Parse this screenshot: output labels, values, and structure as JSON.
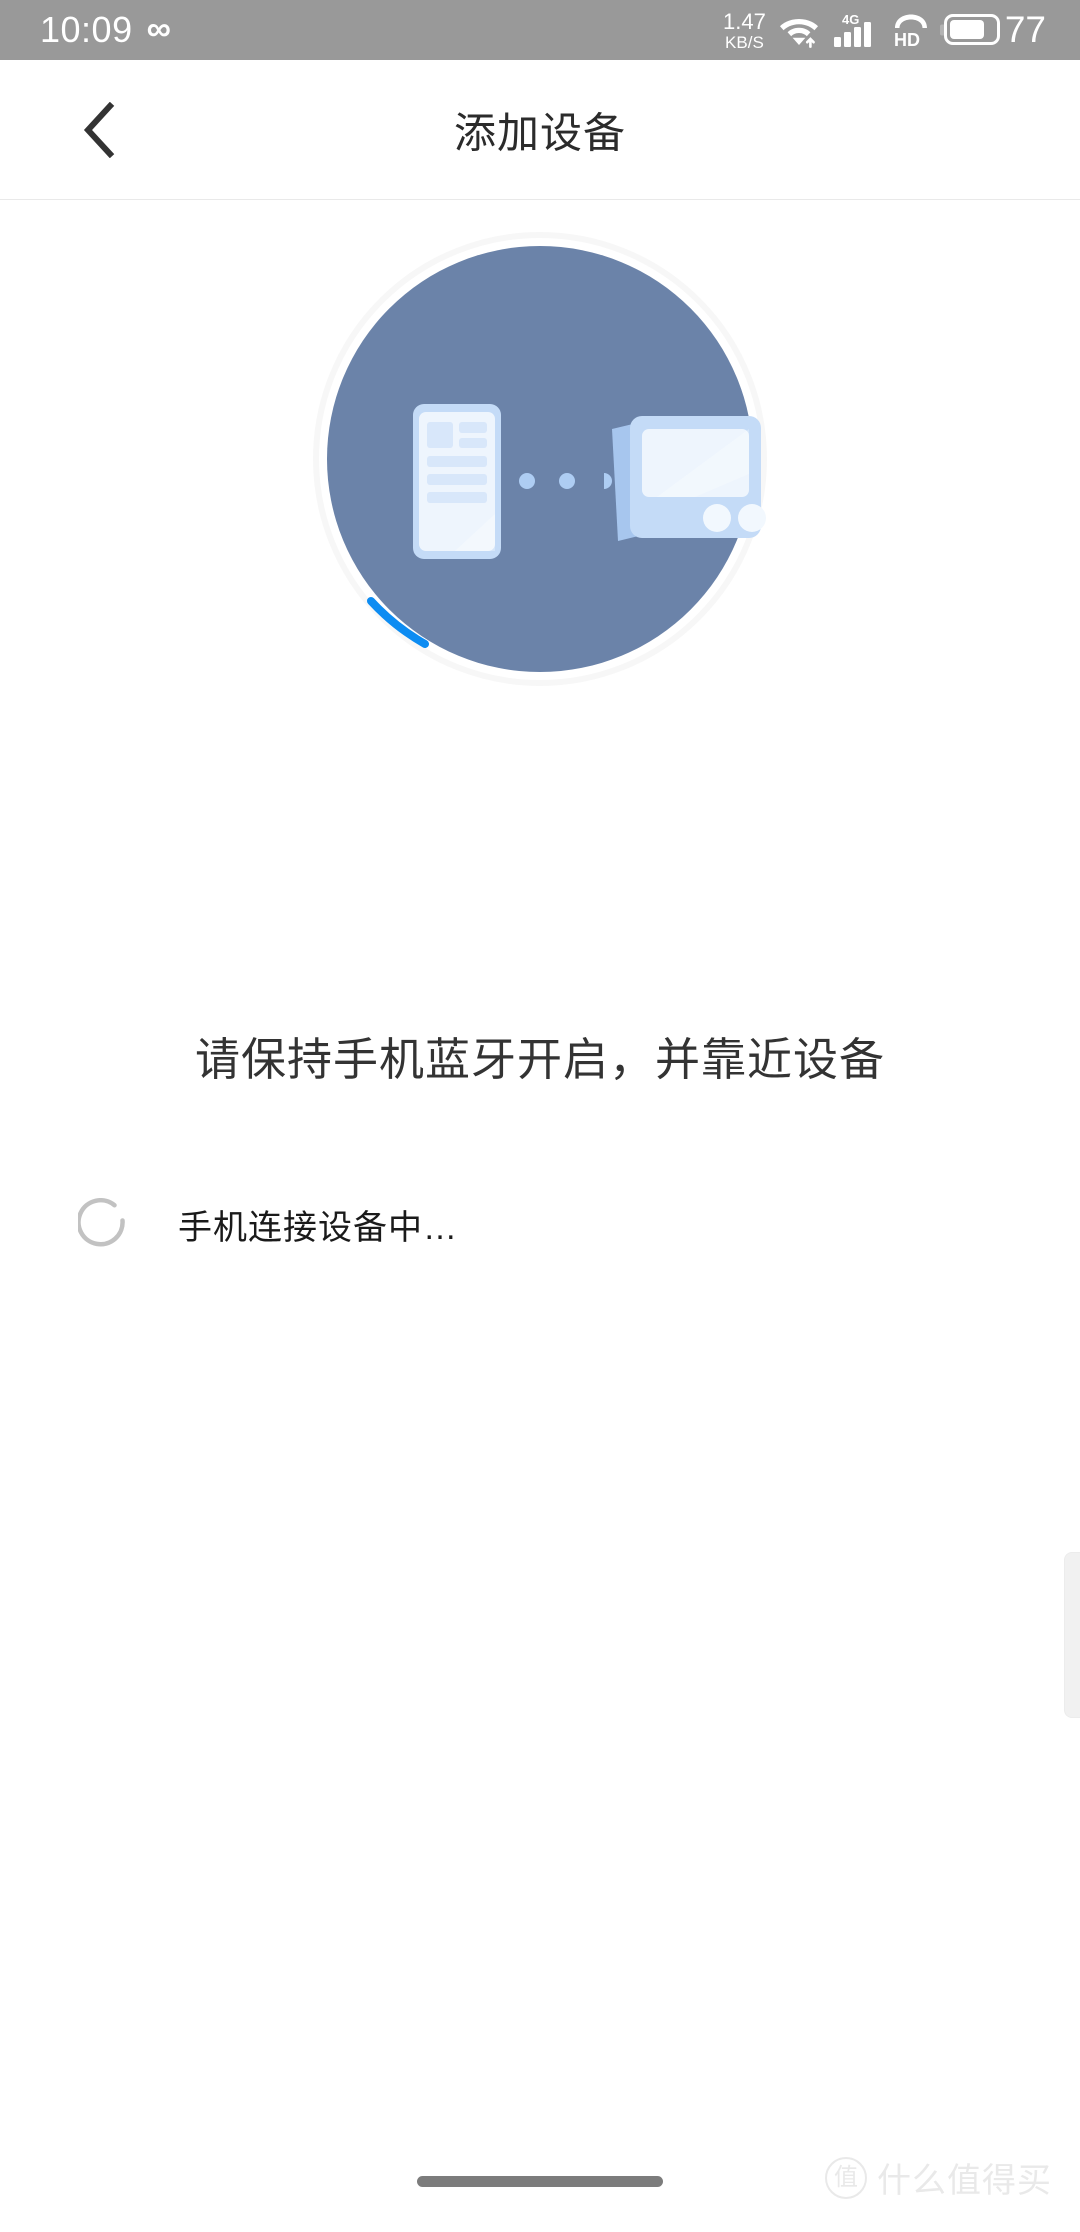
{
  "status_bar": {
    "time": "10:09",
    "infinity_icon": "infinity-icon",
    "network_speed_value": "1.47",
    "network_speed_unit": "KB/S",
    "wifi_icon": "wifi-icon",
    "mobile_network_label": "4G",
    "signal_icon": "signal-bars-icon",
    "volte_hd_label": "HD",
    "battery_icon": "battery-icon",
    "battery_percent": "77",
    "background_color": "#999999"
  },
  "header": {
    "back_icon": "back-chevron-icon",
    "title": "添加设备"
  },
  "illustration": {
    "name": "pairing-illustration",
    "circle_color": "#6b83a9",
    "ring_color": "#f7f7f7",
    "progress_arc_color": "#0d8cf2",
    "device_light_color": "#c4dbf7",
    "device_screen_color": "#eaf3fd",
    "dot_color": "#aecdf3",
    "phone_icon": "phone-icon",
    "device_icon": "device-screen-icon",
    "connection_dots": 3
  },
  "main": {
    "hint_text": "请保持手机蓝牙开启，并靠近设备",
    "status_spinner_icon": "loading-spinner-icon",
    "status_text": "手机连接设备中…"
  },
  "watermark": {
    "badge_char": "值",
    "text": "什么值得买"
  },
  "navigation": {
    "home_indicator": "home-indicator"
  }
}
